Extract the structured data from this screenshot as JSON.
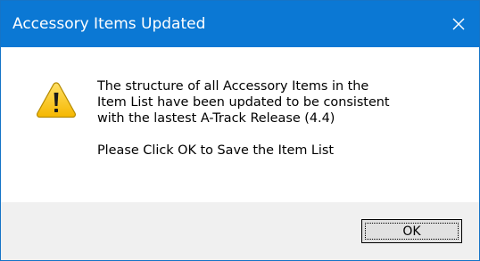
{
  "window": {
    "title": "Accessory Items Updated",
    "title_bar_color": "#0b78d4"
  },
  "icons": {
    "close": "close-icon",
    "warning": "warning-icon"
  },
  "message": {
    "lines": [
      "The structure of all Accessory Items in the",
      "Item List have been updated to be consistent",
      "with the lastest A-Track Release (4.4)"
    ],
    "instruction": "Please Click OK to Save the Item List"
  },
  "buttons": {
    "ok_label": "OK"
  }
}
